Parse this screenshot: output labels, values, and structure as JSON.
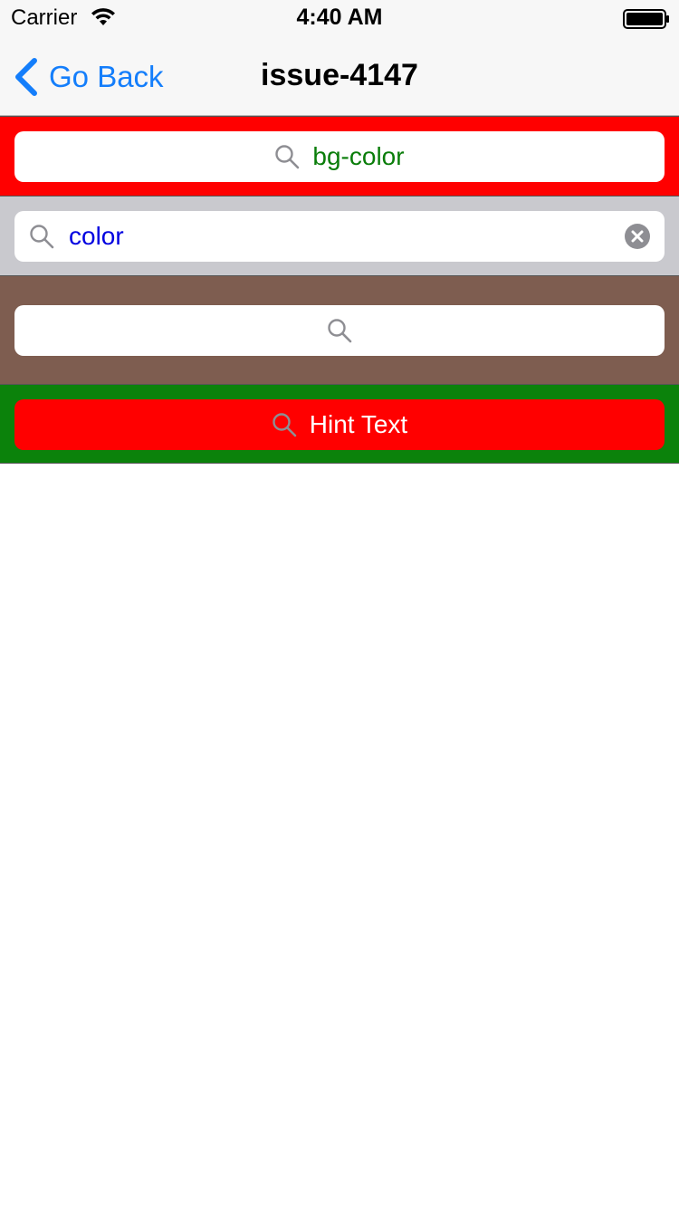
{
  "status_bar": {
    "carrier": "Carrier",
    "time": "4:40 AM"
  },
  "nav": {
    "back_label": "Go Back",
    "title": "issue-4147",
    "accent_color": "#147efb"
  },
  "search_bars": [
    {
      "text": "bg-color",
      "text_color": "#0a7d0a",
      "bar_background": "#ff0000",
      "field_background": "#ffffff",
      "icon": "search-icon"
    },
    {
      "text": "color",
      "text_color": "#0000e0",
      "bar_background": "#c9c9ce",
      "field_background": "#ffffff",
      "icon": "search-icon",
      "clear_icon": "clear-icon"
    },
    {
      "text": "",
      "bar_background": "#7e5d50",
      "field_background": "#ffffff",
      "icon": "search-icon"
    },
    {
      "placeholder": "Hint Text",
      "text_color": "#ffffff",
      "bar_background": "#0b820b",
      "field_background": "#ff0000",
      "icon": "search-icon"
    }
  ]
}
